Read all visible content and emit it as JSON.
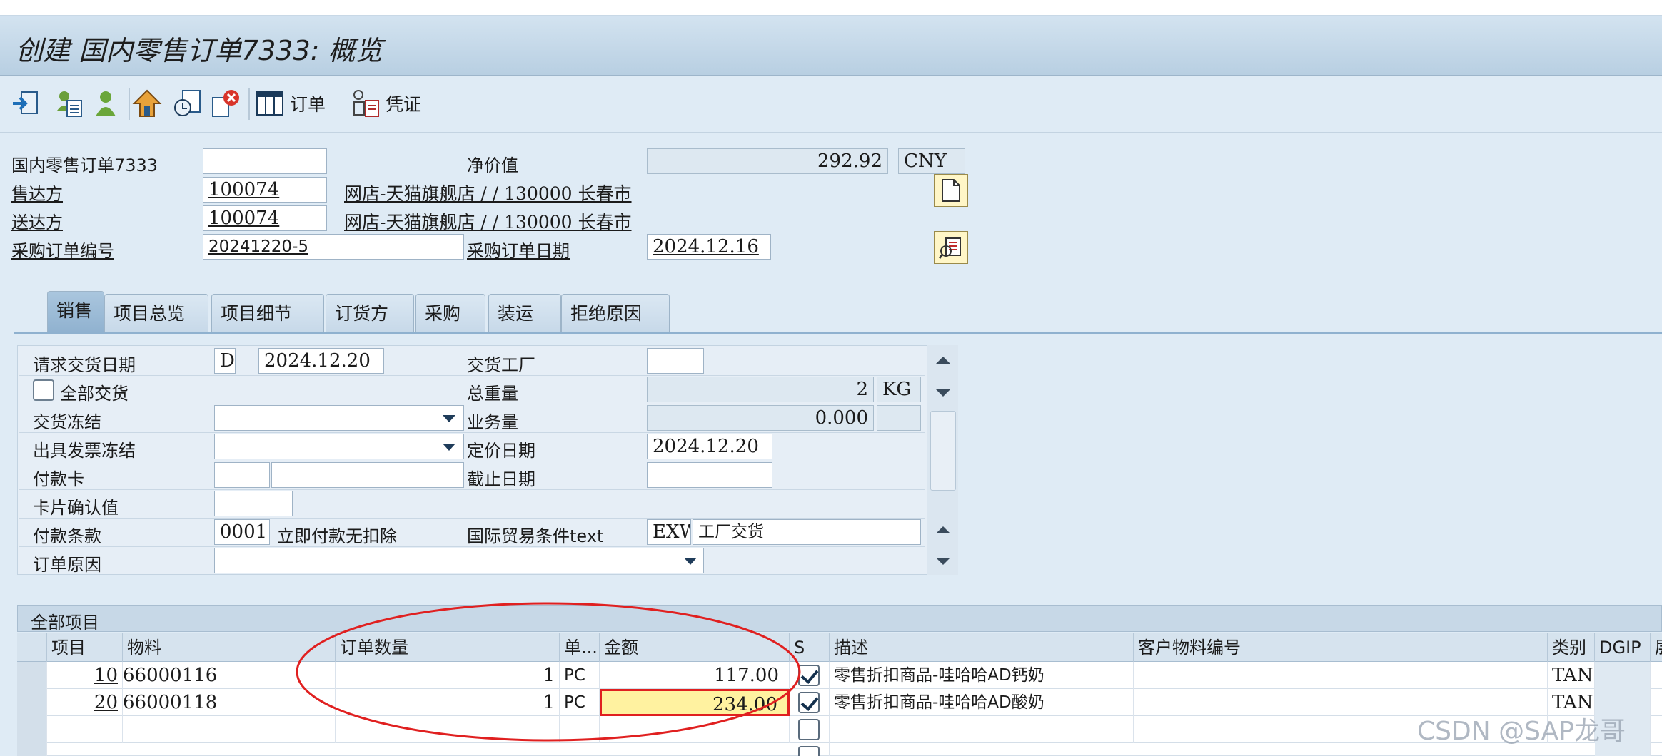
{
  "window": {
    "title": "创建 国内零售订单7333: 概览"
  },
  "toolbar": {
    "order_label": "订单",
    "voucher_label": "凭证"
  },
  "header": {
    "doc_type_label": "国内零售订单7333",
    "doc_type_value": "",
    "net_value_label": "净价值",
    "net_value": "292.92",
    "currency": "CNY",
    "sold_to_label": "售达方",
    "sold_to_value": "100074",
    "sold_to_desc": "网店-天猫旗舰店 / / 130000 长春市",
    "ship_to_label": "送达方",
    "ship_to_value": "100074",
    "ship_to_desc": "网店-天猫旗舰店 / / 130000 长春市",
    "po_number_label": "采购订单编号",
    "po_number_value": "20241220-5",
    "po_date_label": "采购订单日期",
    "po_date_value": "2024.12.16"
  },
  "tabs": [
    "销售",
    "项目总览",
    "项目细节",
    "订货方",
    "采购",
    "装运",
    "拒绝原因"
  ],
  "sales": {
    "req_delivery_date_label": "请求交货日期",
    "req_delivery_date_type": "D",
    "req_delivery_date": "2024.12.20",
    "delivering_plant_label": "交货工厂",
    "delivering_plant_value": "",
    "complete_delivery_label": "全部交货",
    "total_weight_label": "总重量",
    "total_weight": "2",
    "weight_unit": "KG",
    "delivery_block_label": "交货冻结",
    "volume_label": "业务量",
    "volume": "0.000",
    "billing_block_label": "出具发票冻结",
    "pricing_date_label": "定价日期",
    "pricing_date": "2024.12.20",
    "payment_card_label": "付款卡",
    "expiry_date_label": "截止日期",
    "card_verification_label": "卡片确认值",
    "payment_terms_label": "付款条款",
    "payment_terms_code": "0001",
    "payment_terms_desc": "立即付款无扣除",
    "incoterms_label": "国际贸易条件text",
    "incoterms_code": "EXW",
    "incoterms_desc": "工厂交货",
    "order_reason_label": "订单原因"
  },
  "items": {
    "section_title": "全部项目",
    "columns": [
      "项目",
      "物料",
      "订单数量",
      "单...",
      "金额",
      "S",
      "描述",
      "客户物料编号",
      "类别",
      "DGIP",
      "层"
    ],
    "rows": [
      {
        "item": "10",
        "material": "66000116",
        "qty": "1",
        "unit": "PC",
        "amount": "117.00",
        "s_checked": true,
        "desc": "零售折扣商品-哇哈哈AD钙奶",
        "cust_mat": "",
        "category": "TAN"
      },
      {
        "item": "20",
        "material": "66000118",
        "qty": "1",
        "unit": "PC",
        "amount": "234.00",
        "s_checked": true,
        "desc": "零售折扣商品-哇哈哈AD酸奶",
        "cust_mat": "",
        "category": "TAN"
      }
    ]
  },
  "watermark": "CSDN @SAP龙哥",
  "colors": {
    "highlight_cell": "#fff2a0",
    "annotation_ellipse": "#e02020",
    "active_tab": "#8fb1cf"
  }
}
